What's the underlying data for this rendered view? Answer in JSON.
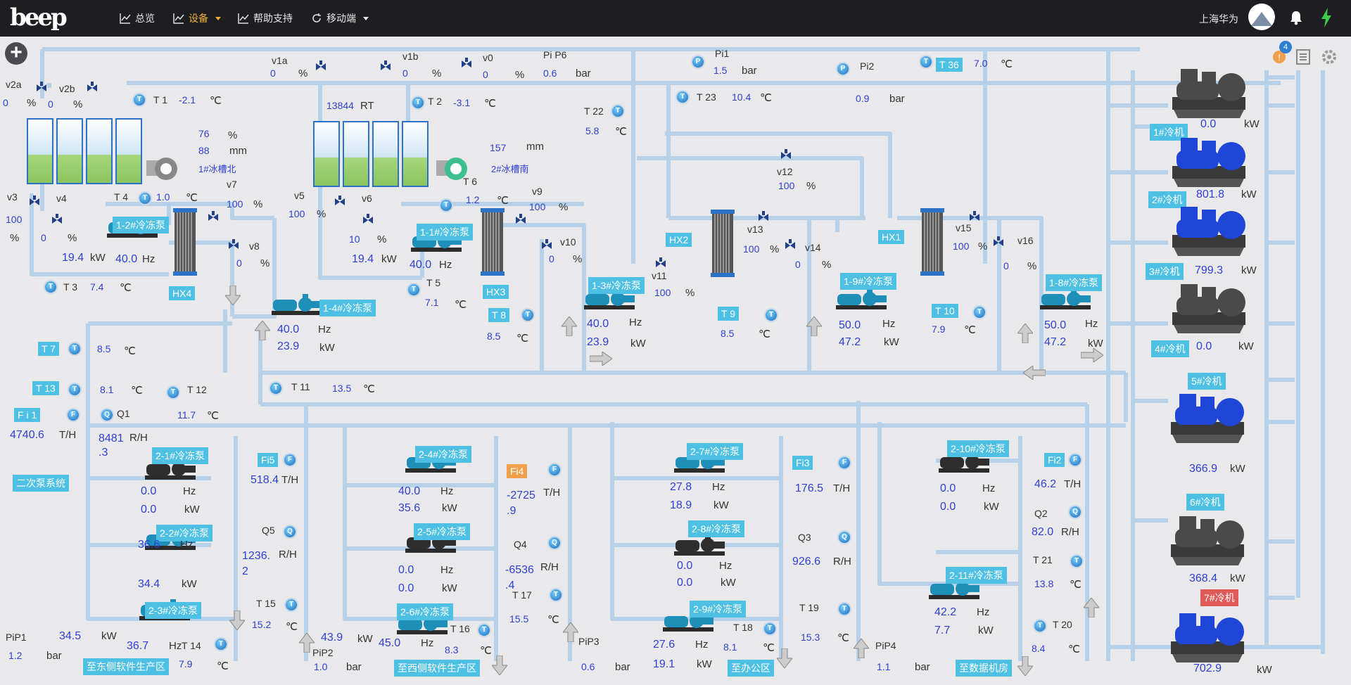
{
  "header": {
    "nav": [
      {
        "label": "总览",
        "icon": "chart-icon"
      },
      {
        "label": "设备",
        "icon": "chart-icon",
        "active": true,
        "dropdown": true
      },
      {
        "label": "帮助支持",
        "icon": "chart-icon"
      },
      {
        "label": "移动端",
        "icon": "refresh-icon",
        "dropdown": true
      }
    ],
    "user": "上海华为",
    "active_color": "#f0b030"
  },
  "notifications": {
    "count": "4"
  },
  "sensors": {
    "v2a": {
      "label": "v2a",
      "value": "0",
      "unit": "%"
    },
    "v2b": {
      "label": "v2b",
      "value": "0",
      "unit": "%"
    },
    "v1a": {
      "label": "v1a",
      "value": "0",
      "unit": "%"
    },
    "v1b": {
      "label": "v1b",
      "value": "0",
      "unit": "%"
    },
    "v0": {
      "label": "v0",
      "value": "0",
      "unit": "%"
    },
    "pip6": {
      "label": "Pi P6",
      "value": "0.6",
      "unit": "bar"
    },
    "pi1": {
      "label": "Pi1",
      "value": "1.5",
      "unit": "bar"
    },
    "pi2": {
      "label": "Pi2",
      "value": "0.9",
      "unit": "bar"
    },
    "t36": {
      "label": "T 36",
      "value": "7.0",
      "unit": "℃"
    },
    "t1": {
      "label": "T 1",
      "value": "-2.1",
      "unit": "℃"
    },
    "t2": {
      "label": "T 2",
      "value": "-3.1",
      "unit": "℃"
    },
    "rt": {
      "value": "13844",
      "unit": "RT"
    },
    "t23": {
      "label": "T 23",
      "value": "10.4",
      "unit": "℃"
    },
    "t22": {
      "label": "T 22",
      "value": "5.8",
      "unit": "℃"
    },
    "tank1_pct": {
      "value": "76",
      "unit": "%"
    },
    "tank1_mm": {
      "value": "88",
      "unit": "mm"
    },
    "tank1_name": "1#冰槽北",
    "tank2_mm": {
      "value": "157",
      "unit": "mm"
    },
    "tank2_name": "2#冰槽南",
    "t6": {
      "label": "T 6",
      "value": "1.2",
      "unit": "℃"
    },
    "v3": {
      "label": "v3",
      "value": "100",
      "unit": "%"
    },
    "v4": {
      "label": "v4",
      "value": "0",
      "unit": "%"
    },
    "t4": {
      "label": "T 4",
      "value": "1.0",
      "unit": "℃"
    },
    "v7": {
      "label": "v7",
      "value": "100",
      "unit": "%"
    },
    "v5": {
      "label": "v5",
      "value": "100",
      "unit": "%"
    },
    "v6": {
      "label": "v6",
      "value": "10",
      "unit": "%"
    },
    "v9": {
      "label": "v9",
      "value": "100",
      "unit": "%"
    },
    "v12": {
      "label": "v12",
      "value": "100",
      "unit": "%"
    },
    "v8": {
      "label": "v8",
      "value": "0",
      "unit": "%"
    },
    "v10": {
      "label": "v10",
      "value": "0",
      "unit": "%"
    },
    "v11": {
      "label": "v11",
      "value": "100",
      "unit": "%"
    },
    "v13": {
      "label": "v13",
      "value": "100",
      "unit": "%"
    },
    "v14": {
      "label": "v14",
      "value": "0",
      "unit": "%"
    },
    "v15": {
      "label": "v15",
      "value": "100",
      "unit": "%"
    },
    "v16": {
      "label": "v16",
      "value": "0",
      "unit": "%"
    },
    "t3": {
      "label": "T 3",
      "value": "7.4",
      "unit": "℃"
    },
    "t5": {
      "label": "T 5",
      "value": "7.1",
      "unit": "℃"
    },
    "t8": {
      "label": "T 8",
      "value": "8.5",
      "unit": "℃"
    },
    "t9": {
      "label": "T 9",
      "value": "8.5",
      "unit": "℃"
    },
    "t10": {
      "label": "T 10",
      "value": "7.9",
      "unit": "℃"
    },
    "t7": {
      "label": "T 7",
      "value": "8.5",
      "unit": "℃"
    },
    "t13": {
      "label": "T 13",
      "value": "8.1",
      "unit": "℃"
    },
    "t12": {
      "label": "T 12",
      "value": "11.7",
      "unit": "℃"
    },
    "t11": {
      "label": "T 11",
      "value": "13.5",
      "unit": "℃"
    },
    "fi1": {
      "label": "F i 1",
      "value": "4740.6",
      "unit": "T/H"
    },
    "q1": {
      "label": "Q1",
      "value": "8481\n.3",
      "unit": "R/H"
    },
    "fi5": {
      "label": "Fi5",
      "value": "518.4",
      "unit": "T/H"
    },
    "q5": {
      "label": "Q5",
      "value": "1236.\n2",
      "unit": "R/H"
    },
    "t15": {
      "label": "T 15",
      "value": "15.2",
      "unit": "℃"
    },
    "pip1": {
      "label": "PiP1",
      "value": "1.2",
      "unit": "bar"
    },
    "pip1_kw": {
      "value": "34.5",
      "unit": "kW"
    },
    "t14": {
      "label": "T 14",
      "value": "7.9",
      "unit": "℃"
    },
    "pip2": {
      "label": "PiP2",
      "value": "1.0",
      "unit": "bar"
    },
    "pip2_kw": {
      "value": "43.9",
      "unit": "kW"
    },
    "fi4": {
      "label": "Fi4",
      "value": "-2725\n.9",
      "unit": "T/H"
    },
    "q4": {
      "label": "Q4",
      "value": "-6536\n.4",
      "unit": "R/H"
    },
    "t17": {
      "label": "T 17",
      "value": "15.5",
      "unit": "℃"
    },
    "t16": {
      "label": "T 16",
      "value": "8.3",
      "unit": "℃"
    },
    "pip3": {
      "label": "PiP3",
      "value": "0.6",
      "unit": "bar"
    },
    "fi3": {
      "label": "Fi3",
      "value": "176.5",
      "unit": "T/H"
    },
    "q3": {
      "label": "Q3",
      "value": "926.6",
      "unit": "R/H"
    },
    "t19": {
      "label": "T 19",
      "value": "15.3",
      "unit": "℃"
    },
    "t18": {
      "label": "T 18",
      "value": "8.1",
      "unit": "℃"
    },
    "pip4": {
      "label": "PiP4",
      "value": "1.1",
      "unit": "bar"
    },
    "fi2": {
      "label": "Fi2",
      "value": "46.2",
      "unit": "T/H"
    },
    "q2": {
      "label": "Q2",
      "value": "82.0",
      "unit": "R/H"
    },
    "t21": {
      "label": "T 21",
      "value": "13.8",
      "unit": "℃"
    },
    "t20": {
      "label": "T 20",
      "value": "8.4",
      "unit": "℃"
    }
  },
  "hx": [
    "HX4",
    "HX3",
    "HX2",
    "HX1"
  ],
  "pumps_primary": [
    {
      "name": "1-2#冷冻泵",
      "kw": "19.4",
      "kw_unit": "kW",
      "hz": "40.0",
      "hz_unit": "Hz"
    },
    {
      "name": "1-1#冷冻泵",
      "kw": "19.4",
      "kw_unit": "kW",
      "hz": "40.0",
      "hz_unit": "Hz"
    },
    {
      "name": "1-4#冷冻泵",
      "hz": "40.0",
      "hz_unit": "Hz",
      "kw": "23.9",
      "kw_unit": "kW"
    },
    {
      "name": "1-3#冷冻泵",
      "hz": "40.0",
      "hz_unit": "Hz",
      "kw": "23.9",
      "kw_unit": "kW"
    },
    {
      "name": "1-9#冷冻泵",
      "hz": "50.0",
      "hz_unit": "Hz",
      "kw": "47.2",
      "kw_unit": "kW"
    },
    {
      "name": "1-8#冷冻泵",
      "hz": "50.0",
      "hz_unit": "Hz",
      "kw": "47.2",
      "kw_unit": "kW"
    }
  ],
  "pumps_secondary": [
    {
      "name": "2-1#冷冻泵",
      "hz": "0.0",
      "kw": "0.0"
    },
    {
      "name": "2-2#冷冻泵",
      "hz": "36.6",
      "kw": "34.4"
    },
    {
      "name": "2-3#冷冻泵",
      "hz": "36.7",
      "kw": ""
    },
    {
      "name": "2-4#冷冻泵",
      "hz": "40.0",
      "kw": "35.6"
    },
    {
      "name": "2-5#冷冻泵",
      "hz": "0.0",
      "kw": "0.0"
    },
    {
      "name": "2-6#冷冻泵",
      "hz": "45.0",
      "kw": ""
    },
    {
      "name": "2-7#冷冻泵",
      "hz": "27.8",
      "kw": "18.9"
    },
    {
      "name": "2-8#冷冻泵",
      "hz": "0.0",
      "kw": "0.0"
    },
    {
      "name": "2-9#冷冻泵",
      "hz": "27.6",
      "kw": "19.1"
    },
    {
      "name": "2-10#冷冻泵",
      "hz": "0.0",
      "kw": "0.0"
    },
    {
      "name": "2-11#冷冻泵",
      "hz": "42.2",
      "kw": "7.7"
    }
  ],
  "units": {
    "hz": "Hz",
    "kw": "kW"
  },
  "chillers": [
    {
      "name": "1#冷机",
      "kw": "0.0",
      "state": "off"
    },
    {
      "name": "2#冷机",
      "kw": "801.8",
      "state": "on"
    },
    {
      "name": "3#冷机",
      "kw": "799.3",
      "state": "on"
    },
    {
      "name": "4#冷机",
      "kw": "0.0",
      "state": "off"
    },
    {
      "name": "5#冷机",
      "kw": "366.9",
      "state": "on"
    },
    {
      "name": "6#冷机",
      "kw": "368.4",
      "state": "off"
    },
    {
      "name": "7#冷机",
      "kw": "702.9",
      "state": "on",
      "alarm": true
    }
  ],
  "zones": {
    "secondary": "二次泵系统",
    "east": "至东侧软件生产区",
    "west": "至西侧软件生产区",
    "office": "至办公区",
    "datacenter": "至数据机房"
  },
  "colors": {
    "tag": "#4dc0e4",
    "value": "#2f3fd4",
    "pipe": "#b7d2e8",
    "alarm": "#e05a5a",
    "orange": "#f0a04a"
  }
}
